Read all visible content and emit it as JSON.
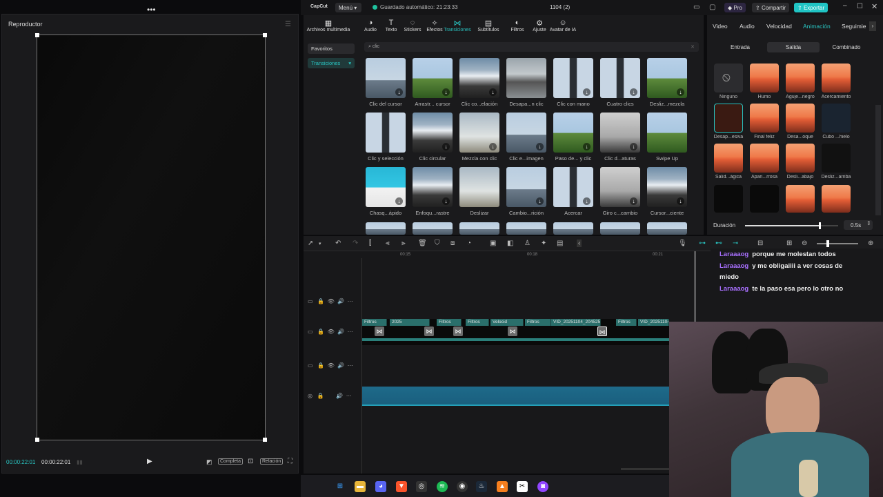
{
  "window": {
    "logo": "CapCut",
    "menu_label": "Menú",
    "autosave": "Guardado automático: 21:23:33",
    "project": "1104 (2)",
    "pro_label": "Pro",
    "share_label": "Compartir",
    "export_label": "Exportar"
  },
  "player": {
    "title": "Reproductor",
    "current_time": "00:00:22:01",
    "total_time": "00:00:22:01",
    "full_label": "Completa",
    "ratio_label": "Relación"
  },
  "toolbar": {
    "items": [
      "Archivos multimedia",
      "Audio",
      "Texto",
      "Stickers",
      "Efectos",
      "Transiciones",
      "Subtítulos",
      "Filtros",
      "Ajuste",
      "Avatar de IA"
    ],
    "active": "Transiciones"
  },
  "media": {
    "sidebar": [
      "Favoritos",
      "Transiciones"
    ],
    "search_value": "clic",
    "thumbs": [
      [
        "Clic del cursor",
        "Arrastr... cursor",
        "Clic co...elación",
        "Desapa...n clic",
        "Clic con mano",
        "Cuatro clics",
        "Desliz...mezcla"
      ],
      [
        "Clic y selección",
        "Clic circular",
        "Mezcla con clic",
        "Clic e...imagen",
        "Paso de... y clic",
        "Clic d...aturas",
        "Swipe Up"
      ],
      [
        "Chasq...ápido",
        "Enfoqu...rastre",
        "Deslizar",
        "Cambio...rición",
        "Acercar",
        "Giro c...cambio",
        "Cursor...ciente"
      ]
    ]
  },
  "props": {
    "tabs": [
      "Video",
      "Audio",
      "Velocidad",
      "Animación",
      "Seguimie"
    ],
    "active_tab": "Animación",
    "segments": [
      "Entrada",
      "Salida",
      "Combinado"
    ],
    "active_segment": "Salida",
    "anims": [
      [
        "Ninguno",
        "Humo",
        "Aguje...negro",
        "Acercamiento"
      ],
      [
        "Desap...esiva",
        "Final feliz",
        "Desa...oque",
        "Cubo ...hielo"
      ],
      [
        "Salid...ágica",
        "Apari...rrosa",
        "Desli...abajo",
        "Desliz...arriba"
      ]
    ],
    "duration_label": "Duración",
    "duration_value": "0.5s",
    "duration_fraction": 0.8
  },
  "timeline": {
    "ruler": [
      "00:15",
      "00:18",
      "00:21"
    ],
    "clips": [
      "Filtros",
      "2025",
      "Filtros",
      "20251",
      "Filtros",
      "Filtros",
      "Velocid",
      "Filtros",
      "VID_20251104_204525",
      "Filtros",
      "VID_20251104_204600"
    ]
  },
  "chat": [
    {
      "user": "Laraaaog",
      "msg": "porque me molestan todos"
    },
    {
      "user": "Laraaaog",
      "msg": "y me obligaiiii a ver cosas de miedo"
    },
    {
      "user": "Laraaaog",
      "msg": "te la paso esa pero lo otro no"
    }
  ]
}
